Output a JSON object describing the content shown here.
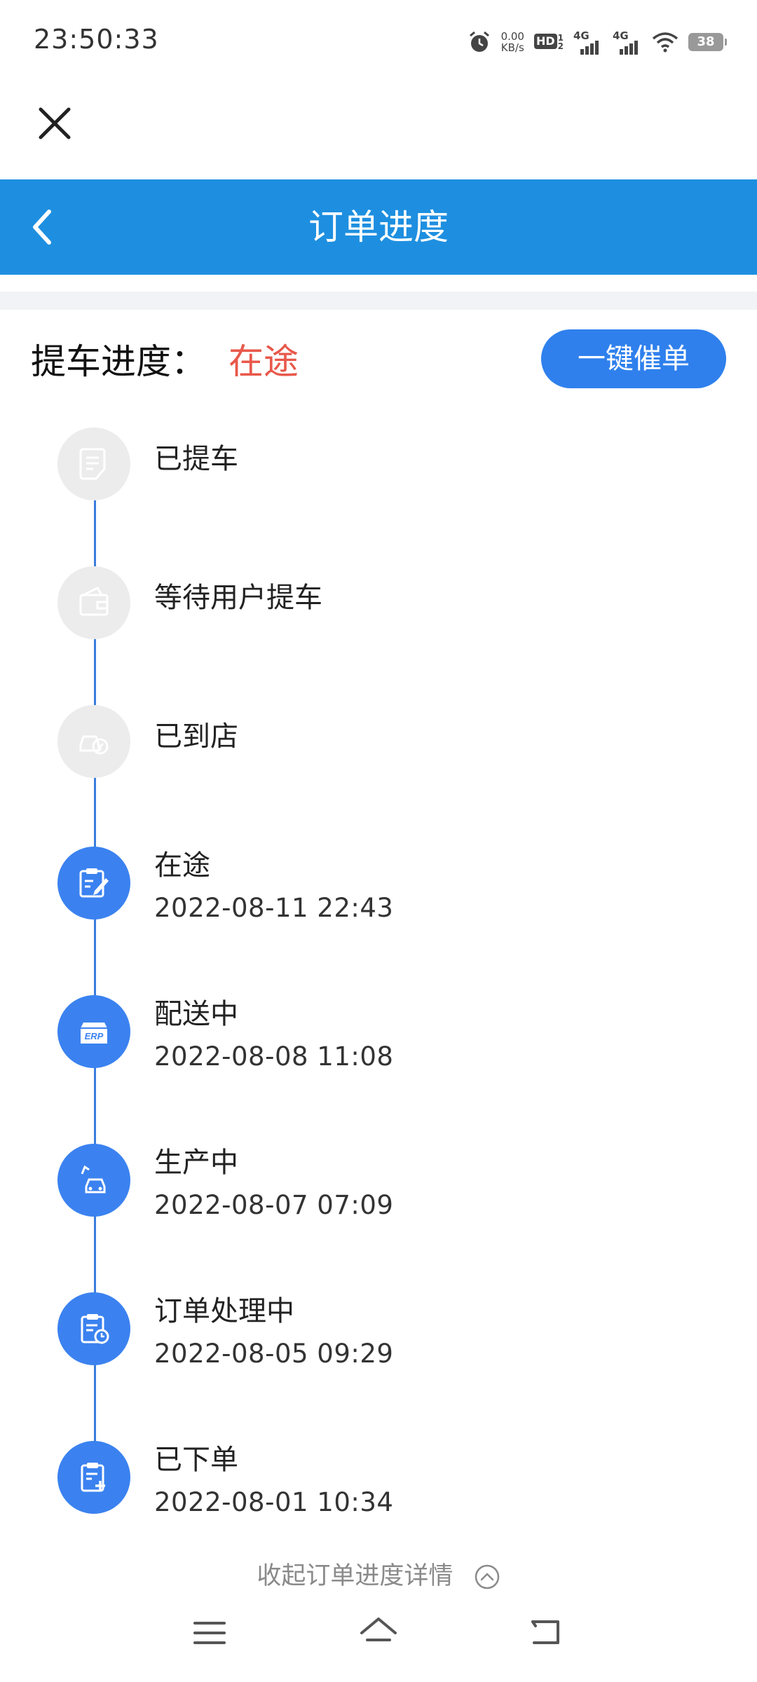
{
  "status_bar": {
    "time": "23:50:33",
    "net_speed_value": "0.00",
    "net_speed_unit": "KB/s",
    "hd_label": "HD",
    "hd_sub_top": "1",
    "hd_sub_bottom": "2",
    "signal1_label": "4G",
    "signal2_label": "4G",
    "battery": "38",
    "icons": [
      "alarm-icon",
      "hd-icon",
      "signal-icon",
      "signal-icon",
      "wifi-icon",
      "battery-icon"
    ]
  },
  "header": {
    "title": "订单进度"
  },
  "progress": {
    "label": "提车进度：",
    "status": "在途",
    "urge_button": "一键催单"
  },
  "steps": [
    {
      "title": "已提车",
      "time": "",
      "state": "pending",
      "icon": "document-icon"
    },
    {
      "title": "等待用户提车",
      "time": "",
      "state": "pending",
      "icon": "wallet-icon"
    },
    {
      "title": "已到店",
      "time": "",
      "state": "pending",
      "icon": "car-store-icon"
    },
    {
      "title": "在途",
      "time": "2022-08-11 22:43",
      "state": "done",
      "icon": "edit-document-icon"
    },
    {
      "title": "配送中",
      "time": "2022-08-08 11:08",
      "state": "done",
      "icon": "erp-box-icon"
    },
    {
      "title": "生产中",
      "time": "2022-08-07 07:09",
      "state": "done",
      "icon": "car-production-icon"
    },
    {
      "title": "订单处理中",
      "time": "2022-08-05 09:29",
      "state": "done",
      "icon": "clipboard-clock-icon"
    },
    {
      "title": "已下单",
      "time": "2022-08-01 10:34",
      "state": "done",
      "icon": "clipboard-plus-icon"
    }
  ],
  "erp_text": "ERP",
  "collapse_label": "收起订单进度详情",
  "colors": {
    "header_bg": "#1e8fe0",
    "accent_blue": "#3b82f0",
    "status_red": "#e8584a",
    "pending_gray": "#ececec"
  }
}
